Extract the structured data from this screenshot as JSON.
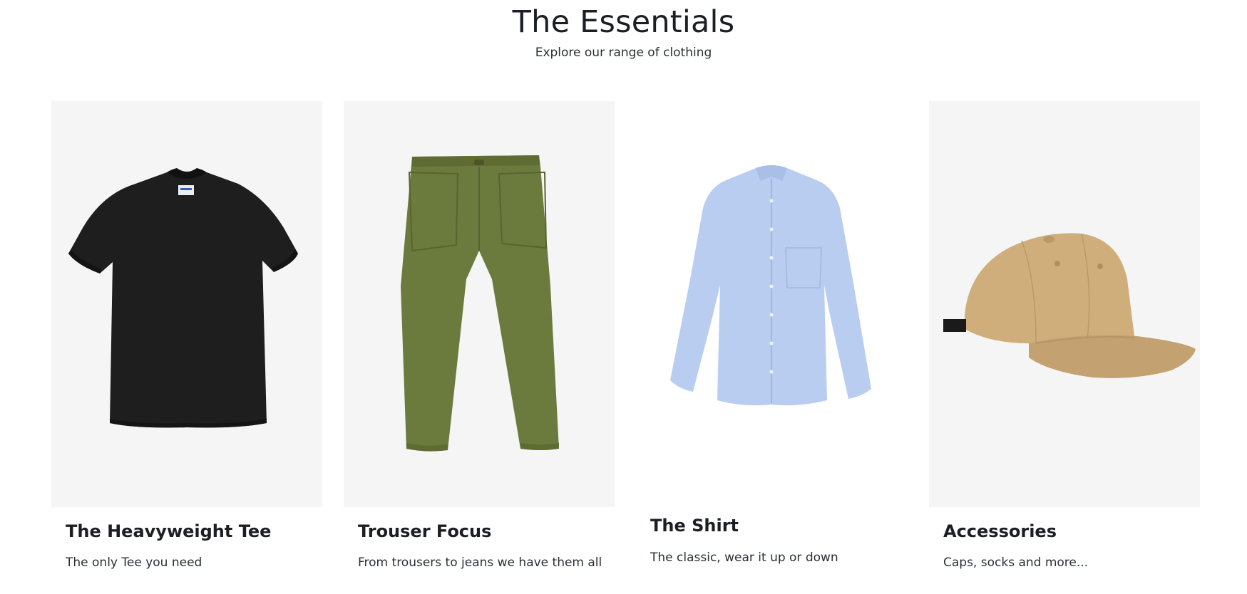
{
  "header": {
    "title": "The Essentials",
    "subtitle": "Explore our range of clothing"
  },
  "cards": [
    {
      "title": "The Heavyweight Tee",
      "description": "The only Tee you need",
      "image_icon": "black-tshirt-image",
      "image_bg": "#f5f5f5",
      "product_color": "#1e1e1e"
    },
    {
      "title": "Trouser Focus",
      "description": "From trousers to jeans we have them all",
      "image_icon": "green-trousers-image",
      "image_bg": "#f5f5f5",
      "product_color": "#6b7a3d"
    },
    {
      "title": "The Shirt",
      "description": "The classic, wear it up or down",
      "image_icon": "blue-shirt-image",
      "image_bg": "#ffffff",
      "product_color": "#b9cdf0"
    },
    {
      "title": "Accessories",
      "description": "Caps, socks and more...",
      "image_icon": "tan-cap-image",
      "image_bg": "#f5f5f5",
      "product_color": "#cfae7c"
    }
  ]
}
